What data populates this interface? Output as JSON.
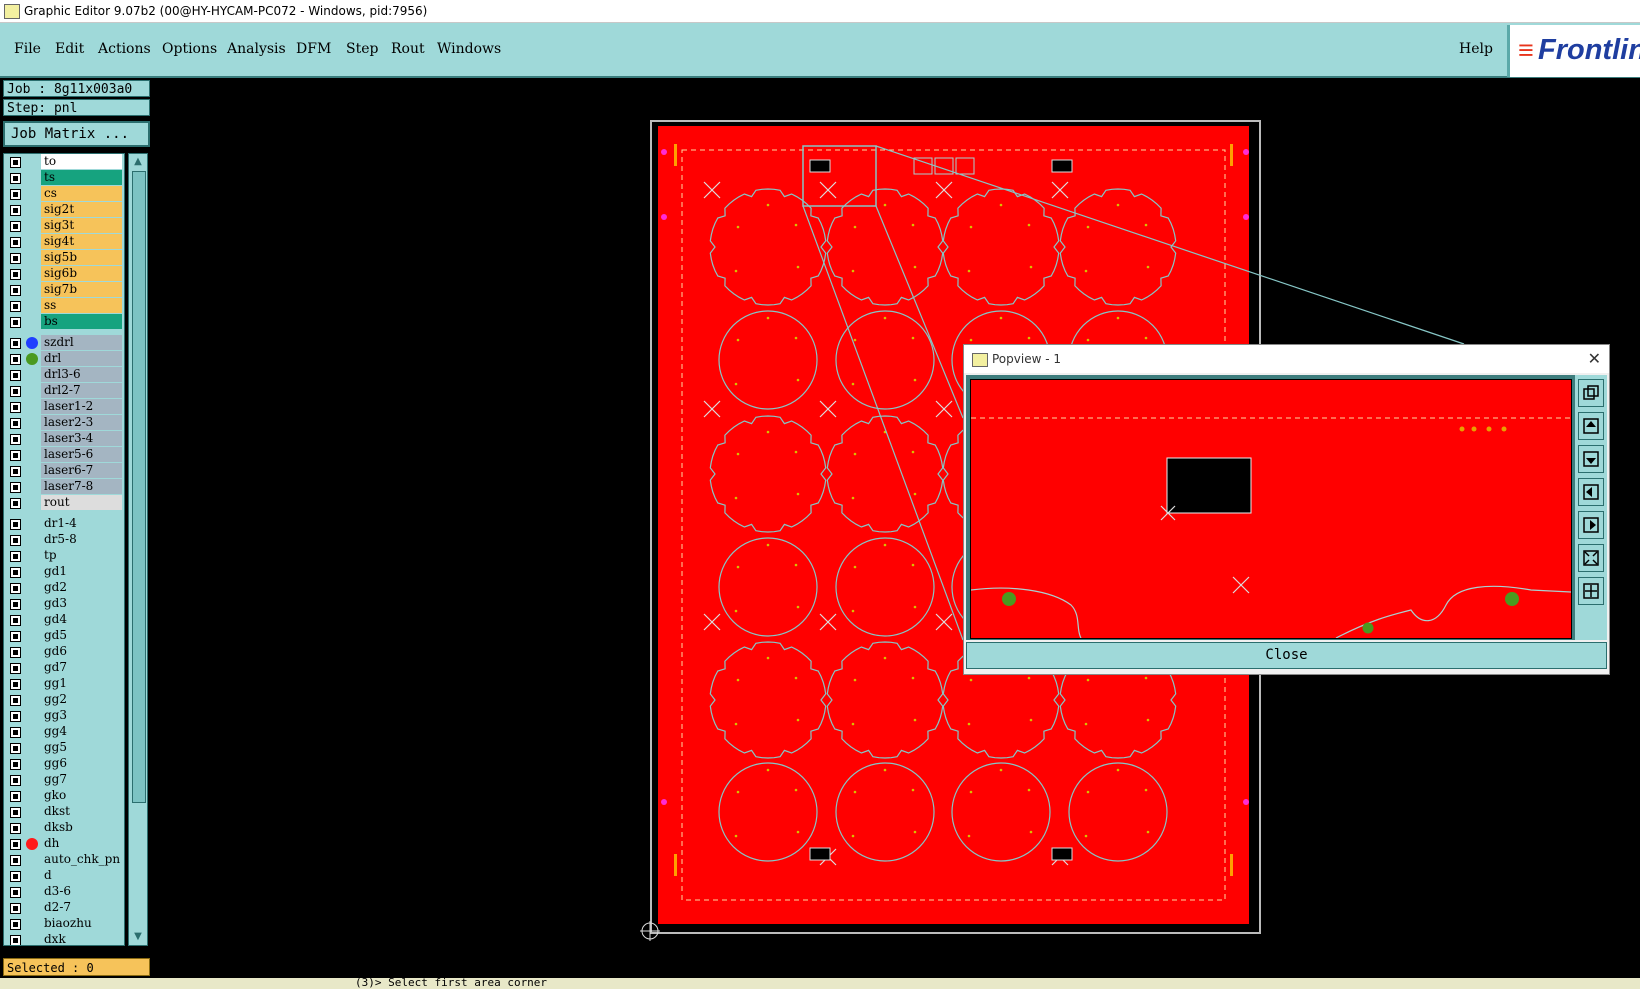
{
  "window": {
    "title": "Graphic Editor 9.07b2 (00@HY-HYCAM-PC072 - Windows, pid:7956)"
  },
  "menu": {
    "items": [
      "File",
      "Edit",
      "Actions",
      "Options",
      "Analysis",
      "DFM",
      "Step",
      "Rout",
      "Windows"
    ],
    "help": "Help"
  },
  "logo": {
    "text": "Frontlin"
  },
  "job": {
    "label": "Job : 8g11x003a0",
    "step": "Step: pnl",
    "matrix_button": "Job Matrix ..."
  },
  "layers": [
    {
      "name": "to",
      "color": "#ffffff"
    },
    {
      "name": "ts",
      "color": "#16a37f"
    },
    {
      "name": "cs",
      "color": "#f6c35a"
    },
    {
      "name": "sig2t",
      "color": "#f6c35a"
    },
    {
      "name": "sig3t",
      "color": "#f6c35a"
    },
    {
      "name": "sig4t",
      "color": "#f6c35a"
    },
    {
      "name": "sig5b",
      "color": "#f6c35a"
    },
    {
      "name": "sig6b",
      "color": "#f6c35a"
    },
    {
      "name": "sig7b",
      "color": "#f6c35a"
    },
    {
      "name": "ss",
      "color": "#f6c35a"
    },
    {
      "name": "bs",
      "color": "#16a37f"
    },
    {
      "name": "szdrl",
      "color": "#a4b5c2",
      "dot": "#2040ff"
    },
    {
      "name": "drl",
      "color": "#a4b5c2",
      "dot": "#4a9a20"
    },
    {
      "name": "drl3-6",
      "color": "#a4b5c2"
    },
    {
      "name": "drl2-7",
      "color": "#a4b5c2"
    },
    {
      "name": "laser1-2",
      "color": "#a4b5c2"
    },
    {
      "name": "laser2-3",
      "color": "#a4b5c2"
    },
    {
      "name": "laser3-4",
      "color": "#a4b5c2"
    },
    {
      "name": "laser5-6",
      "color": "#a4b5c2"
    },
    {
      "name": "laser6-7",
      "color": "#a4b5c2"
    },
    {
      "name": "laser7-8",
      "color": "#a4b5c2"
    },
    {
      "name": "rout",
      "color": "#dddddd"
    },
    {
      "name": "dr1-4",
      "color": "#9fd9d9"
    },
    {
      "name": "dr5-8",
      "color": "#9fd9d9"
    },
    {
      "name": "tp",
      "color": "#9fd9d9"
    },
    {
      "name": "gd1",
      "color": "#9fd9d9"
    },
    {
      "name": "gd2",
      "color": "#9fd9d9"
    },
    {
      "name": "gd3",
      "color": "#9fd9d9"
    },
    {
      "name": "gd4",
      "color": "#9fd9d9"
    },
    {
      "name": "gd5",
      "color": "#9fd9d9"
    },
    {
      "name": "gd6",
      "color": "#9fd9d9"
    },
    {
      "name": "gd7",
      "color": "#9fd9d9"
    },
    {
      "name": "gg1",
      "color": "#9fd9d9"
    },
    {
      "name": "gg2",
      "color": "#9fd9d9"
    },
    {
      "name": "gg3",
      "color": "#9fd9d9"
    },
    {
      "name": "gg4",
      "color": "#9fd9d9"
    },
    {
      "name": "gg5",
      "color": "#9fd9d9"
    },
    {
      "name": "gg6",
      "color": "#9fd9d9"
    },
    {
      "name": "gg7",
      "color": "#9fd9d9"
    },
    {
      "name": "gko",
      "color": "#9fd9d9"
    },
    {
      "name": "dkst",
      "color": "#9fd9d9"
    },
    {
      "name": "dksb",
      "color": "#9fd9d9"
    },
    {
      "name": "dh",
      "color": "#9fd9d9",
      "dot": "#ff1a1a"
    },
    {
      "name": "auto_chk_pn",
      "color": "#9fd9d9"
    },
    {
      "name": "d",
      "color": "#9fd9d9"
    },
    {
      "name": "d3-6",
      "color": "#9fd9d9"
    },
    {
      "name": "d2-7",
      "color": "#9fd9d9"
    },
    {
      "name": "biaozhu",
      "color": "#9fd9d9"
    },
    {
      "name": "dxk",
      "color": "#9fd9d9"
    }
  ],
  "selected": "Selected : 0",
  "status": "(3)>  Select first area corner",
  "popview": {
    "title": "Popview - 1",
    "close_label": "Close"
  },
  "colors": {
    "board": "#ff0000",
    "outline": "#86c6c6",
    "panel": "#9fd9d9"
  }
}
